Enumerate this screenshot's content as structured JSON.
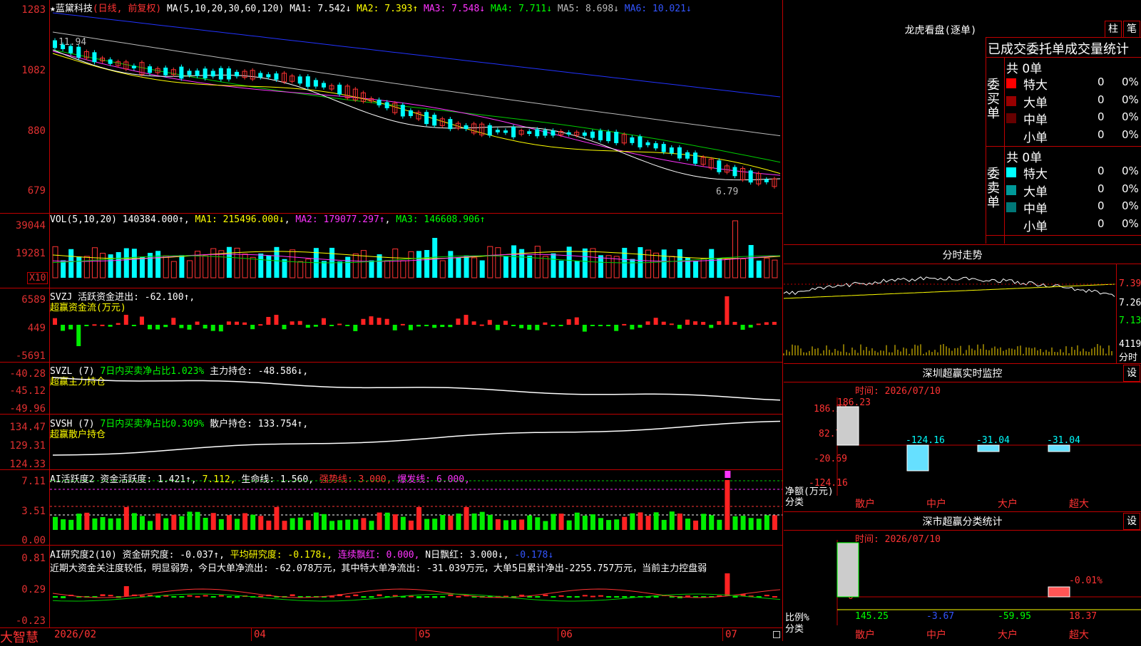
{
  "stock": {
    "star": "★",
    "name": "蓝黛科技",
    "period": "(日线, 前复权)",
    "ma_spec": "MA(5,10,20,30,60,120)",
    "ma1": "MA1: 7.542↓",
    "ma2": "MA2: 7.393↑",
    "ma3": "MA3: 7.548↓",
    "ma4": "MA4: 7.711↓",
    "ma5": "MA5: 8.698↓",
    "ma6": "MA6: 10.021↓",
    "high_mark": "11.94",
    "low_mark": "6.79"
  },
  "price_axis": [
    "1283",
    "1082",
    "880",
    "679"
  ],
  "vol": {
    "spec": "VOL(5,10,20)",
    "value": "140384.000↑",
    "ma1": "MA1: 215496.000↓",
    "ma2": "MA2: 179077.297↑",
    "ma3": "MA3: 146608.906↑",
    "axis": [
      "39044",
      "19281"
    ],
    "unit": "X10"
  },
  "svzj": {
    "line1": "SVZJ  活跃资金进出: -62.100↑,",
    "line2": "超赢资金流(万元)",
    "axis": [
      "6589",
      "449",
      "-5691"
    ]
  },
  "svzl": {
    "spec": "SVZL (7)",
    "ratio": "7日内买卖净占比1.023%",
    "hold": "主力持仓: -48.586↓,",
    "line2": "超赢主力持仓",
    "axis": [
      "-40.28",
      "-45.12",
      "-49.96"
    ]
  },
  "svsh": {
    "spec": "SVSH (7)",
    "ratio": "7日内买卖净占比0.309%",
    "hold": "散户持仓: 133.754↑,",
    "line2": "超赢散户持仓",
    "axis": [
      "134.47",
      "129.31",
      "124.33"
    ]
  },
  "ai1": {
    "spec": "AI活跃度2",
    "act": "资金活跃度: 1.421↑,",
    "v2": "7.112,",
    "life": "生命线: 1.560,",
    "strong": "强势线: 3.000,",
    "burst": "爆发线: 6.000,",
    "axis": [
      "7.11",
      "3.51",
      "0.00"
    ]
  },
  "ai2": {
    "spec": "AI研究度2(10)",
    "research": "资金研究度: -0.037↑,",
    "avg": "平均研究度: -0.178↓,",
    "cont": "连续飘红: 0.000,",
    "nday": "N日飘红: 3.000↓,",
    "last": "-0.178↓",
    "comment": "近期大资金关注度较低，明显弱势，今日大单净流出: -62.078万元，其中特大单净流出: -31.039万元，大单5日累计净出-2255.757万元，当前主力控盘弱",
    "axis": [
      "0.81",
      "0.29",
      "-0.23"
    ]
  },
  "date_axis": [
    "2026/02",
    "04",
    "05",
    "06",
    "07"
  ],
  "brand": "大智慧",
  "longhu": {
    "title": "龙虎看盘(逐单)",
    "btn_zhu": "柱",
    "btn_bi": "笔",
    "subtitle": "已成交委托单成交量统计",
    "buy_label": "委买单",
    "sell_label": "委卖单",
    "buy_total": "共 0单",
    "sell_total": "共 0单",
    "buy_rows": [
      {
        "name": "特大",
        "count": "0",
        "pct": "0%",
        "color": "#ff0000"
      },
      {
        "name": "大单",
        "count": "0",
        "pct": "0%",
        "color": "#990000"
      },
      {
        "name": "中单",
        "count": "0",
        "pct": "0%",
        "color": "#660000"
      },
      {
        "name": "小单",
        "count": "0",
        "pct": "0%",
        "color": "#000000"
      }
    ],
    "sell_rows": [
      {
        "name": "特大",
        "count": "0",
        "pct": "0%",
        "color": "#00ffff"
      },
      {
        "name": "大单",
        "count": "0",
        "pct": "0%",
        "color": "#009999"
      },
      {
        "name": "中单",
        "count": "0",
        "pct": "0%",
        "color": "#007777"
      },
      {
        "name": "小单",
        "count": "0",
        "pct": "0%",
        "color": "#000000"
      }
    ]
  },
  "intraday": {
    "title": "分时走势",
    "axis": [
      "7.39",
      "7.26",
      "7.13"
    ],
    "vol_value": "4119",
    "vol_label": "分时"
  },
  "monitor": {
    "title": "深圳超赢实时监控",
    "btn": "设",
    "time": "时间: 2026/07/10",
    "axis": [
      "186.23",
      "82.77",
      "-20.69",
      "-124.16"
    ],
    "y_label": "净额(万元)",
    "x_label": "分类",
    "categories": [
      "散户",
      "中户",
      "大户",
      "超大"
    ],
    "values": [
      186.23,
      -124.16,
      -31.04,
      -31.04
    ],
    "value_labels": [
      "186.23",
      "-124.16",
      "-31.04",
      "-31.04"
    ]
  },
  "classify": {
    "title": "深市超赢分类统计",
    "btn": "设",
    "time": "时间: 2026/07/10",
    "axis": [
      "75",
      "50",
      "25",
      "0"
    ],
    "y_label": "比例%",
    "x_label": "分类",
    "categories": [
      "散户",
      "中户",
      "大户",
      "超大"
    ],
    "values": [
      145.25,
      -3.67,
      -59.95,
      18.37
    ],
    "value_labels": [
      "145.25",
      "-3.67",
      "-59.95",
      "18.37"
    ],
    "extra": "-0.01%"
  }
}
